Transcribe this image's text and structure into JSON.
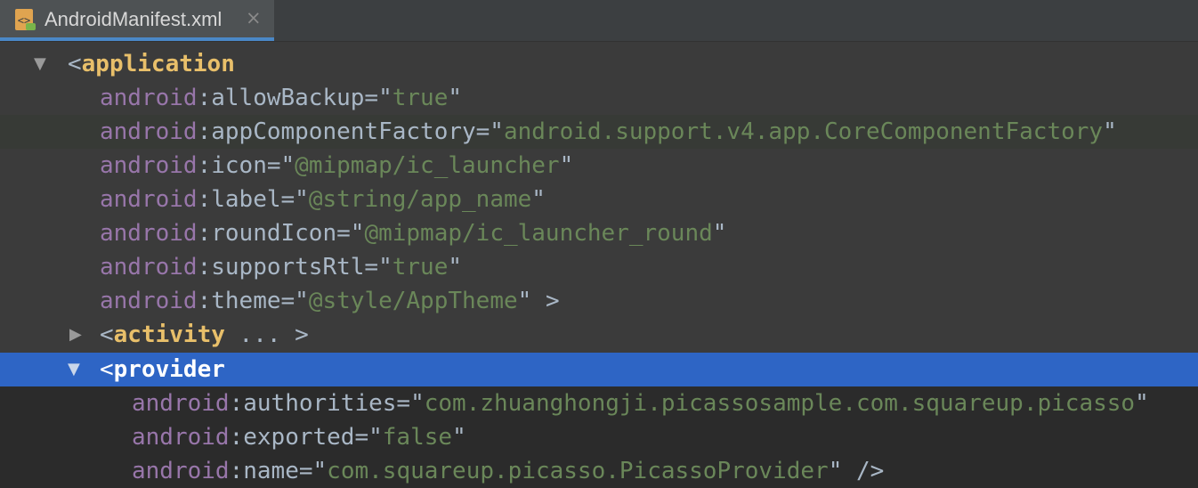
{
  "tab": {
    "label": "AndroidManifest.xml",
    "icon": "xml-file-icon",
    "close": "×"
  },
  "lines": {
    "application_open": {
      "lt": "<",
      "tag": "application"
    },
    "allowBackup": {
      "ns": "android",
      "colon": ":",
      "name": "allowBackup",
      "eq": "=\"",
      "value": "true",
      "end": "\""
    },
    "appComponentFactory": {
      "ns": "android",
      "colon": ":",
      "name": "appComponentFactory",
      "eq": "=\"",
      "value": "android.support.v4.app.CoreComponentFactory",
      "end": "\""
    },
    "icon": {
      "ns": "android",
      "colon": ":",
      "name": "icon",
      "eq": "=\"",
      "value": "@mipmap/ic_launcher",
      "end": "\""
    },
    "label": {
      "ns": "android",
      "colon": ":",
      "name": "label",
      "eq": "=\"",
      "value": "@string/app_name",
      "end": "\""
    },
    "roundIcon": {
      "ns": "android",
      "colon": ":",
      "name": "roundIcon",
      "eq": "=\"",
      "value": "@mipmap/ic_launcher_round",
      "end": "\""
    },
    "supportsRtl": {
      "ns": "android",
      "colon": ":",
      "name": "supportsRtl",
      "eq": "=\"",
      "value": "true",
      "end": "\""
    },
    "theme": {
      "ns": "android",
      "colon": ":",
      "name": "theme",
      "eq": "=\"",
      "value": "@style/AppTheme",
      "end": "\" >"
    },
    "activity": {
      "lt": "<",
      "tag": "activity",
      "rest": " ... >"
    },
    "provider_open": {
      "lt": "<",
      "tag": "provider"
    },
    "authorities": {
      "ns": "android",
      "colon": ":",
      "name": "authorities",
      "eq": "=\"",
      "value": "com.zhuanghongji.picassosample.com.squareup.picasso",
      "end": "\""
    },
    "exported": {
      "ns": "android",
      "colon": ":",
      "name": "exported",
      "eq": "=\"",
      "value": "false",
      "end": "\""
    },
    "name": {
      "ns": "android",
      "colon": ":",
      "name": "name",
      "eq": "=\"",
      "value": "com.squareup.picasso.PicassoProvider",
      "end": "\" />"
    }
  },
  "colors": {
    "attr_namespace": "#9876aa",
    "attr_value": "#6a8759",
    "tag": "#e8bf6a",
    "text": "#a9b7c6",
    "selection": "#2e65c5"
  },
  "glyphs": {
    "expanded": "▼",
    "collapsed": "▶"
  }
}
